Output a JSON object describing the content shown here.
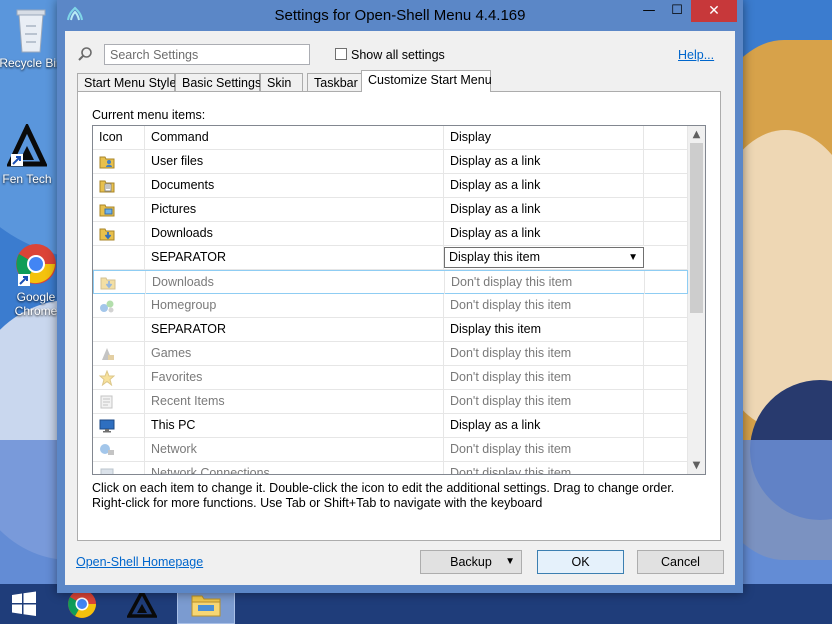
{
  "desktop": {
    "icons": [
      {
        "label": "Recycle Bin",
        "icon": "recycle-bin-icon"
      },
      {
        "label": "Fen Tech",
        "icon": "fentech-icon"
      },
      {
        "label": "Google Chrome",
        "icon": "chrome-icon"
      }
    ]
  },
  "window": {
    "title": "Settings for Open-Shell Menu 4.4.169",
    "minimize": "—",
    "maximize": "☐",
    "close": "✕"
  },
  "toolbar": {
    "search_placeholder": "Search Settings",
    "show_all_label": "Show all settings",
    "show_all_checked": false,
    "help_label": "Help..."
  },
  "tabs": [
    {
      "label": "Start Menu Style",
      "selected": false
    },
    {
      "label": "Basic Settings",
      "selected": false
    },
    {
      "label": "Skin",
      "selected": false
    },
    {
      "label": "Taskbar",
      "selected": false
    },
    {
      "label": "Customize Start Menu",
      "selected": true
    }
  ],
  "panel": {
    "label": "Current menu items:",
    "columns": [
      "Icon",
      "Command",
      "Display"
    ],
    "rows": [
      {
        "icon": "user-files-icon",
        "command": "User files",
        "display": "Display as a link",
        "dim": false
      },
      {
        "icon": "documents-icon",
        "command": "Documents",
        "display": "Display as a link",
        "dim": false
      },
      {
        "icon": "pictures-icon",
        "command": "Pictures",
        "display": "Display as a link",
        "dim": false
      },
      {
        "icon": "downloads-icon",
        "command": "Downloads",
        "display": "Display as a link",
        "dim": false
      },
      {
        "icon": "",
        "command": "SEPARATOR",
        "display": "Display this item",
        "dim": false,
        "dropdown": true
      },
      {
        "icon": "downloads-icon",
        "command": "Downloads",
        "display": "Don't display this item",
        "dim": true,
        "selected": true
      },
      {
        "icon": "homegroup-icon",
        "command": "Homegroup",
        "display": "Don't display this item",
        "dim": true
      },
      {
        "icon": "",
        "command": "SEPARATOR",
        "display": "Display this item",
        "dim": false
      },
      {
        "icon": "games-icon",
        "command": "Games",
        "display": "Don't display this item",
        "dim": true
      },
      {
        "icon": "favorites-icon",
        "command": "Favorites",
        "display": "Don't display this item",
        "dim": true
      },
      {
        "icon": "recent-items-icon",
        "command": "Recent Items",
        "display": "Don't display this item",
        "dim": true
      },
      {
        "icon": "this-pc-icon",
        "command": "This PC",
        "display": "Display as a link",
        "dim": false
      },
      {
        "icon": "network-icon",
        "command": "Network",
        "display": "Don't display this item",
        "dim": true
      },
      {
        "icon": "network-connections-icon",
        "command": "Network Connections",
        "display": "Don't display this item",
        "dim": true
      }
    ],
    "hint_line1": "Click on each item to change it. Double-click the icon to edit the additional settings. Drag to change order.",
    "hint_line2": "Right-click for more functions. Use Tab or Shift+Tab to navigate with the keyboard"
  },
  "footer": {
    "homepage_label": "Open-Shell Homepage",
    "backup_label": "Backup",
    "ok_label": "OK",
    "cancel_label": "Cancel"
  },
  "taskbar": {
    "items": [
      "start-icon",
      "chrome-icon",
      "fentech-icon",
      "file-explorer-icon"
    ]
  }
}
